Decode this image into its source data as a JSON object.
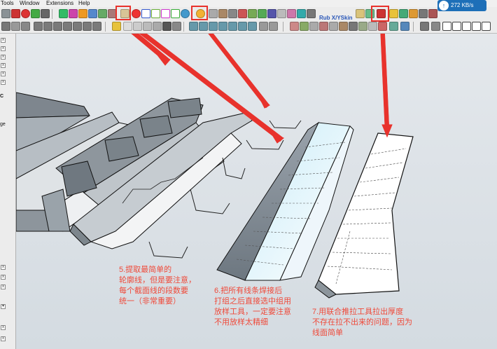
{
  "menu": {
    "tools": "Tools",
    "window": "Window",
    "extensions": "Extensions",
    "help": "Help"
  },
  "toolbar": {
    "rubx_label": "Rub X/YSkin"
  },
  "network_widget": {
    "speed": "272 KB/s",
    "icon": "network-speed-icon"
  },
  "left_panel": {
    "label_ge": "ge",
    "label_c": "C"
  },
  "highlight_color": "#e8322c",
  "annotations": {
    "step5": {
      "line1": "5.提取最简单的",
      "line2": "轮廓线，但是要注意，",
      "line3": "每个截面线的段数要",
      "line4": "统一（非常重要）"
    },
    "step6": {
      "line1": "6.把所有线条焊接后",
      "line2": "打组之后直接选中组用",
      "line3": "放样工具，一定要注意",
      "line4": "不用放样太精细"
    },
    "step7": {
      "line1": "7.用联合推拉工具拉出厚度",
      "line2": "不存在拉不出来的问题，因为",
      "line3": "线面简单"
    }
  }
}
